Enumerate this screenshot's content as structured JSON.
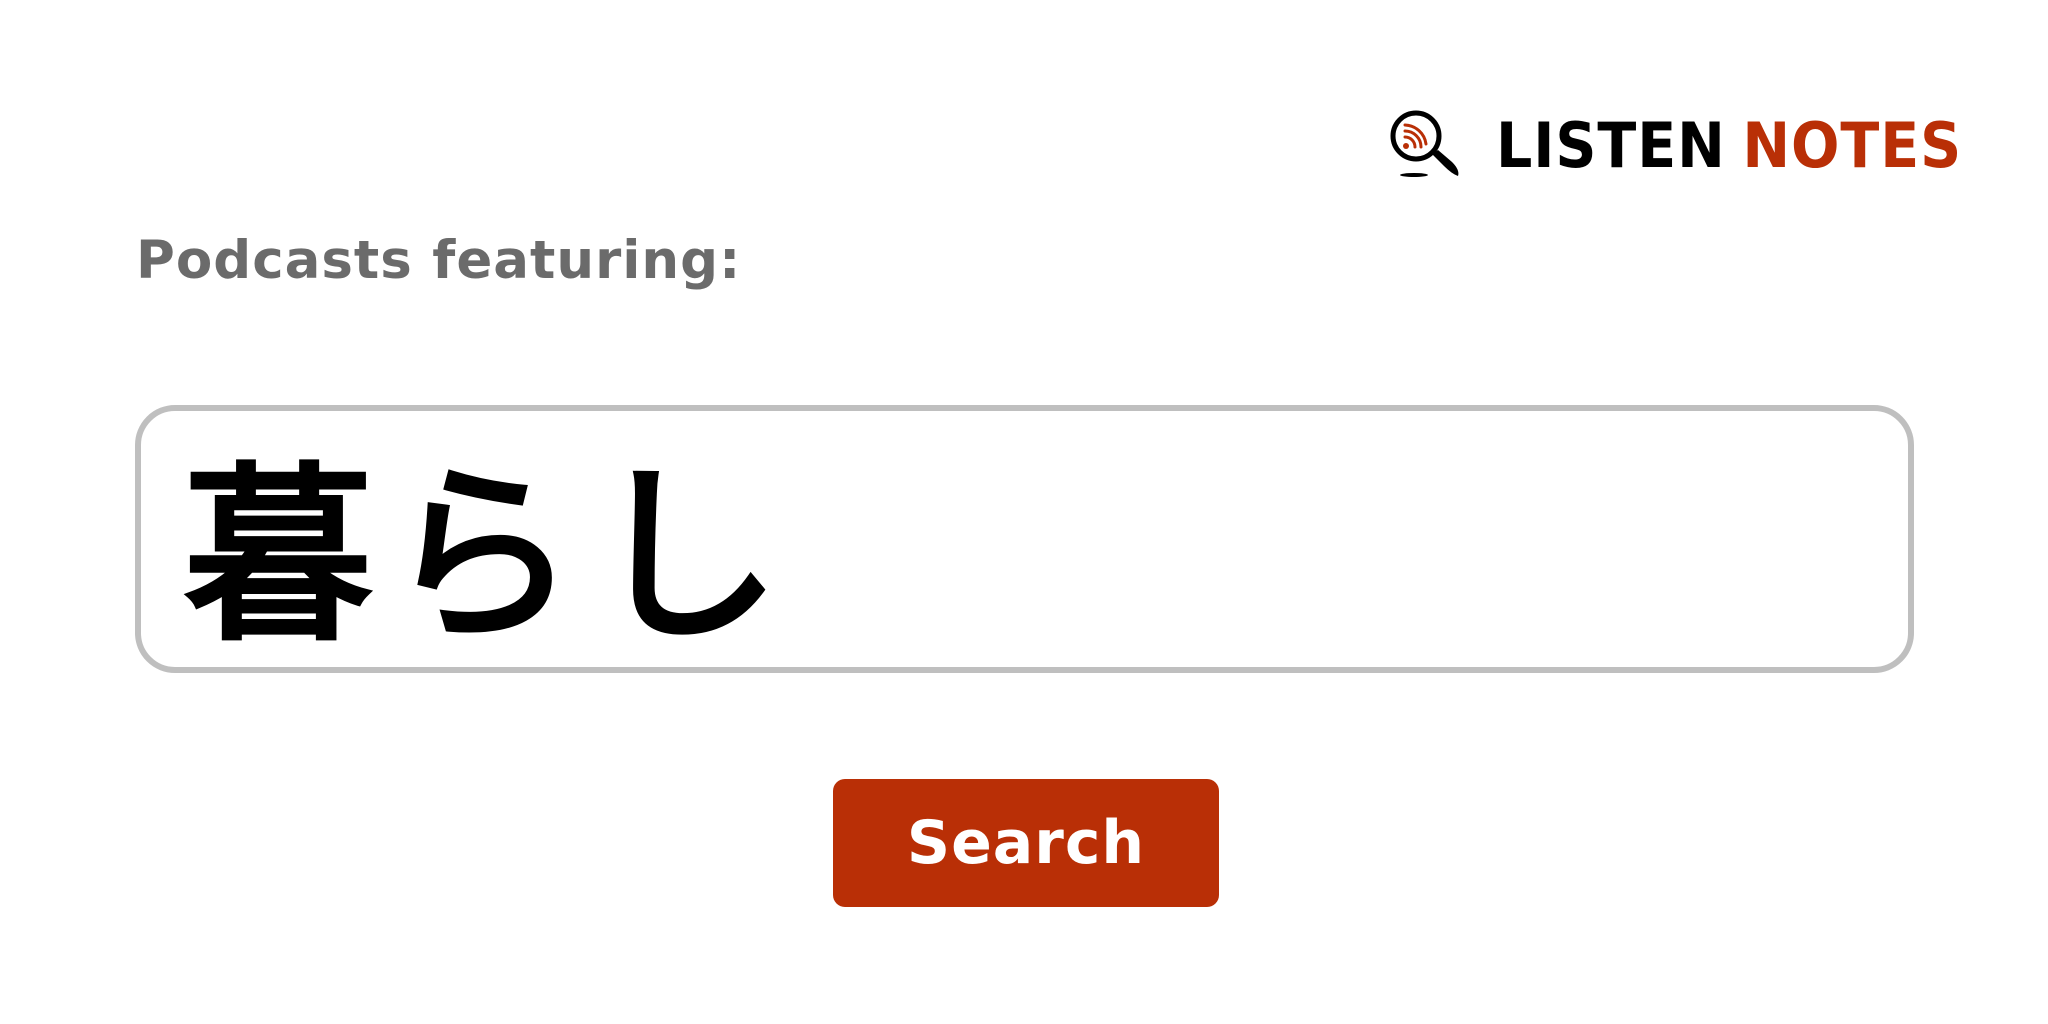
{
  "logo": {
    "word_1": "LISTEN",
    "word_2": "NOTES",
    "icon": "magnifier-rss-icon",
    "colors": {
      "dark": "#000000",
      "accent": "#b92f06"
    }
  },
  "heading": "Podcasts featuring:",
  "search": {
    "value": "暮らし",
    "placeholder": ""
  },
  "button": {
    "label": "Search",
    "color": "#b92f06"
  }
}
